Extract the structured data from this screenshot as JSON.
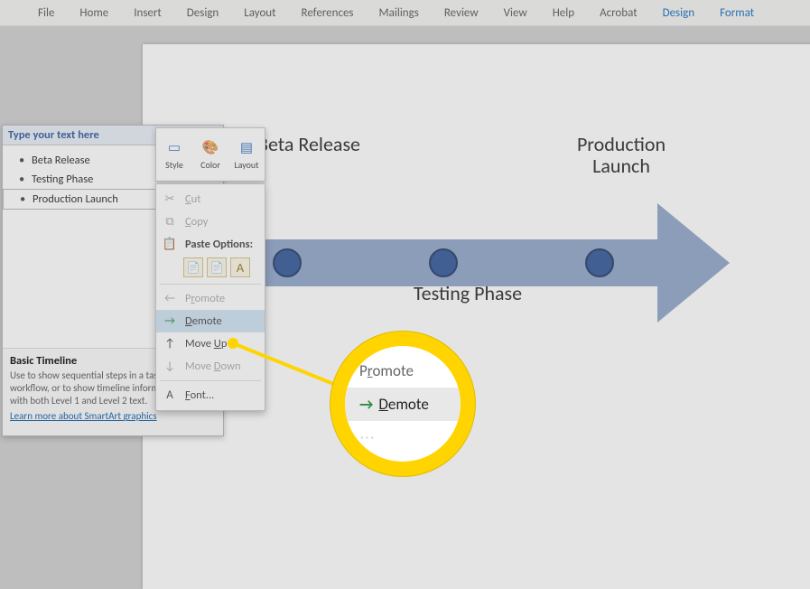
{
  "ribbon": {
    "tabs": [
      "File",
      "Home",
      "Insert",
      "Design",
      "Layout",
      "References",
      "Mailings",
      "Review",
      "View",
      "Help",
      "Acrobat"
    ],
    "context_tabs": [
      "Design",
      "Format"
    ]
  },
  "textpane": {
    "title": "Type your text here",
    "items": [
      {
        "label": "Beta Release"
      },
      {
        "label": "Testing Phase"
      },
      {
        "label": "Production Launch",
        "selected": true
      }
    ],
    "desc_title": "Basic Timeline",
    "desc_body": "Use to show sequential steps in a task, process, or workflow, or to show timeline information. Works with both Level 1 and Level 2 text.",
    "desc_link": "Learn more about SmartArt graphics"
  },
  "minitb": {
    "style": "Style",
    "color": "Color",
    "layout": "Layout"
  },
  "ctxmenu": {
    "cut": "Cut",
    "copy": "Copy",
    "paste_hdr": "Paste Options:",
    "promote": "Promote",
    "demote": "Demote",
    "moveup": "Move Up",
    "movedown": "Move Down",
    "font": "Font..."
  },
  "timeline": {
    "n1": "Beta Release",
    "n2": "Testing Phase",
    "n3": "Production Launch"
  },
  "mag": {
    "promote": "Promote",
    "demote": "Demote"
  }
}
